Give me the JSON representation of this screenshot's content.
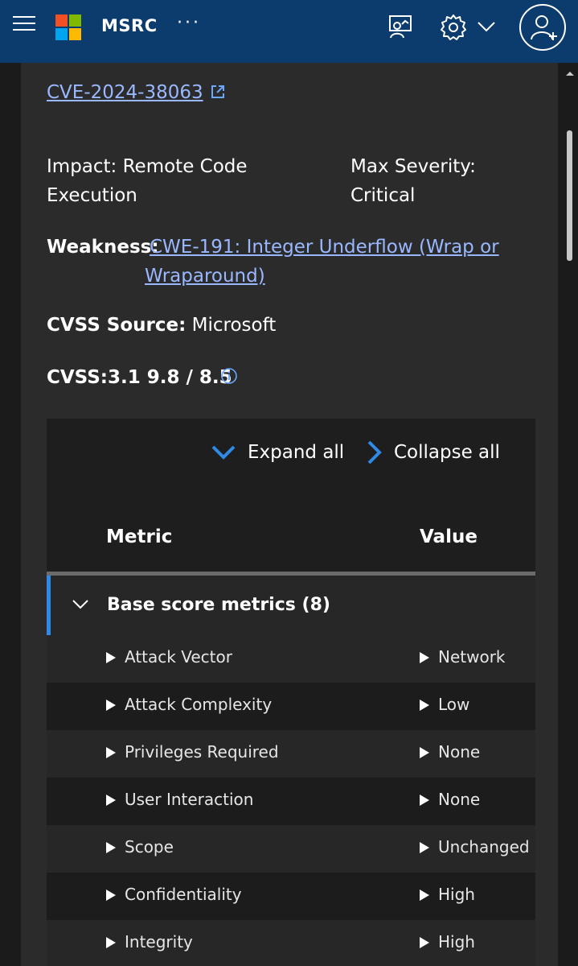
{
  "header": {
    "brand": "MSRC",
    "more": "···",
    "icons": [
      "menu-icon",
      "microsoft-logo",
      "feedback-icon",
      "gear-icon",
      "chevron-down-icon",
      "user-add-icon"
    ]
  },
  "cve": {
    "id": "CVE-2024-38063",
    "impact": "Impact: Remote Code Execution",
    "max_severity": "Max Severity: Critical",
    "weakness_label": "Weakness:",
    "weakness_value": "CWE-191: Integer Underflow (Wrap or Wraparound)",
    "cvss_source_label": "CVSS Source:",
    "cvss_source_value": "Microsoft",
    "cvss_score": "CVSS:3.1 9.8 / 8.5"
  },
  "table": {
    "expand_all": "Expand all",
    "collapse_all": "Collapse all",
    "col_metric": "Metric",
    "col_value": "Value",
    "group_label": "Base score metrics (8)",
    "rows": [
      {
        "metric": "Attack Vector",
        "value": "Network"
      },
      {
        "metric": "Attack Complexity",
        "value": "Low"
      },
      {
        "metric": "Privileges Required",
        "value": "None"
      },
      {
        "metric": "User Interaction",
        "value": "None"
      },
      {
        "metric": "Scope",
        "value": "Unchanged"
      },
      {
        "metric": "Confidentiality",
        "value": "High"
      },
      {
        "metric": "Integrity",
        "value": "High"
      }
    ]
  },
  "colors": {
    "header_bg": "#0c3b6e",
    "accent_blue": "#2f8ae6",
    "link": "#9ab8ff"
  }
}
